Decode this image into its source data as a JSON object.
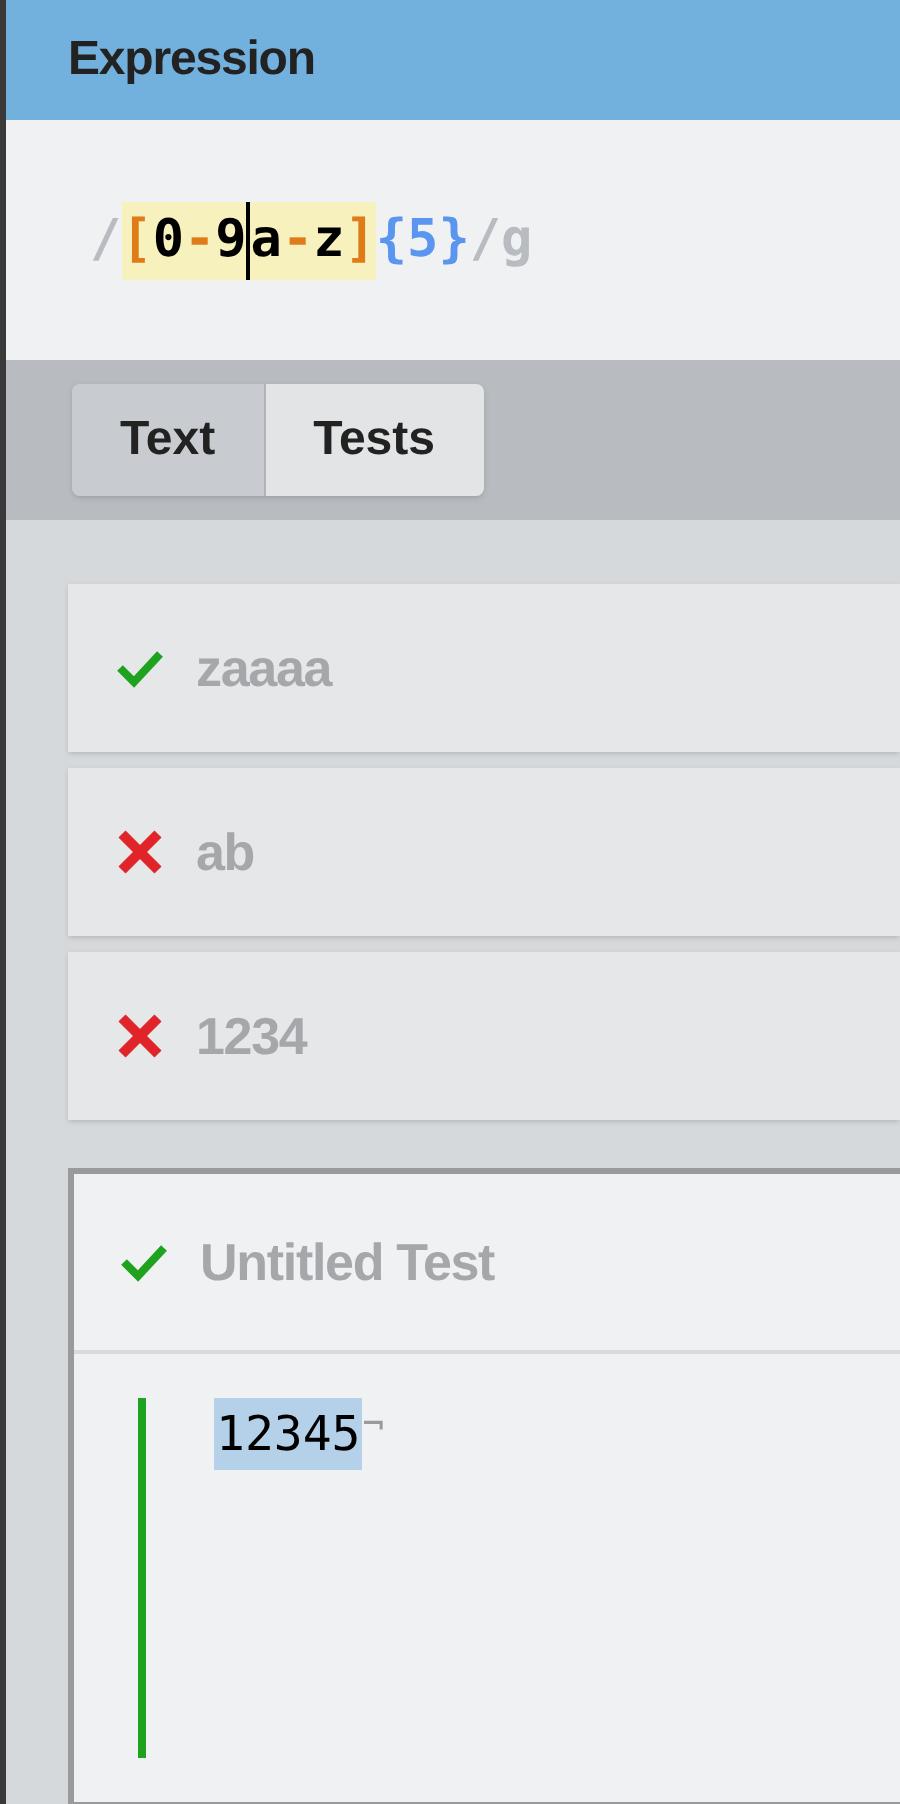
{
  "header": {
    "title": "Expression"
  },
  "expression": {
    "parts": [
      {
        "kind": "delimiter",
        "text": "/"
      },
      {
        "kind": "set",
        "highlighted": true,
        "tokens": [
          {
            "kind": "bracket",
            "text": "[",
            "cursor": false
          },
          {
            "kind": "char",
            "text": "0",
            "cursor": false
          },
          {
            "kind": "range",
            "text": "-",
            "cursor": false
          },
          {
            "kind": "char",
            "text": "9",
            "cursor": true
          },
          {
            "kind": "char",
            "text": "a",
            "cursor": false
          },
          {
            "kind": "range",
            "text": "-",
            "cursor": false
          },
          {
            "kind": "char",
            "text": "z",
            "cursor": false
          },
          {
            "kind": "bracket",
            "text": "]",
            "cursor": false
          }
        ]
      },
      {
        "kind": "quantifier",
        "text": "{5}"
      },
      {
        "kind": "delimiter",
        "text": "/"
      },
      {
        "kind": "flag",
        "text": "g"
      }
    ]
  },
  "tabs": [
    {
      "label": "Text",
      "selected": false
    },
    {
      "label": "Tests",
      "selected": true
    }
  ],
  "tests": [
    {
      "name": "zaaaa",
      "passed": true,
      "expanded": false
    },
    {
      "name": "ab",
      "passed": false,
      "expanded": false
    },
    {
      "name": "1234",
      "passed": false,
      "expanded": false
    },
    {
      "name": "Untitled Test",
      "passed": true,
      "expanded": true,
      "body": {
        "match": "12345",
        "line_end": "¬"
      }
    }
  ]
}
